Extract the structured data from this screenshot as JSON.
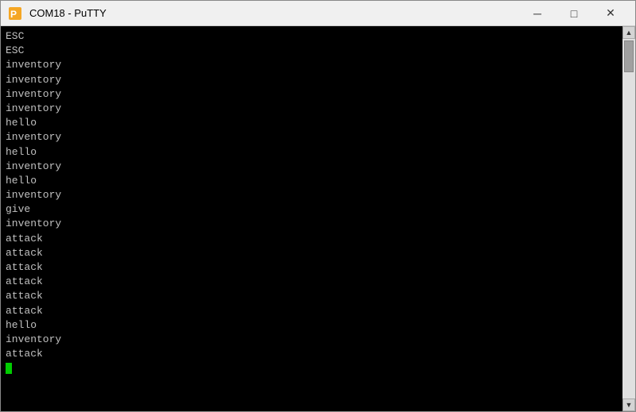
{
  "window": {
    "title": "COM18 - PuTTY"
  },
  "titlebar": {
    "minimize_label": "─",
    "maximize_label": "□",
    "close_label": "✕"
  },
  "terminal": {
    "lines": [
      "ESC",
      "ESC",
      "inventory",
      "inventory",
      "inventory",
      "inventory",
      "hello",
      "inventory",
      "hello",
      "inventory",
      "hello",
      "inventory",
      "give",
      "inventory",
      "attack",
      "attack",
      "attack",
      "attack",
      "attack",
      "attack",
      "hello",
      "inventory",
      "attack"
    ]
  }
}
